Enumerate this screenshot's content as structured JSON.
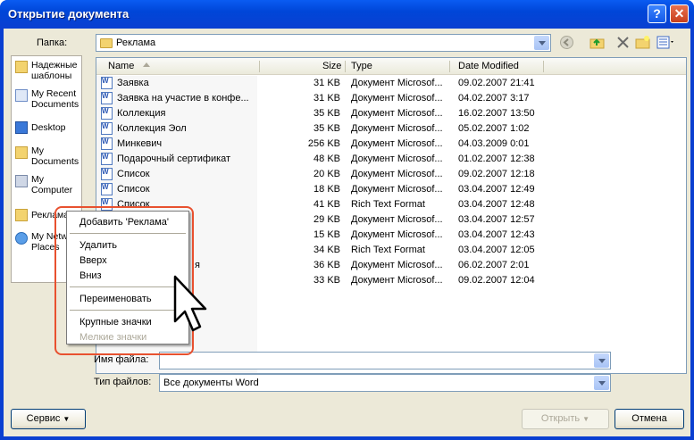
{
  "title": "Открытие документа",
  "titlebar": {
    "help": "?",
    "close": "✕"
  },
  "folder_label": "Папка:",
  "folder_value": "Реклама",
  "places": [
    {
      "label": "Надежные шаблоны"
    },
    {
      "label": "My Recent Documents"
    },
    {
      "label": "Desktop"
    },
    {
      "label": "My Documents"
    },
    {
      "label": "My Computer"
    },
    {
      "label": "Реклама"
    },
    {
      "label": "My Network Places"
    }
  ],
  "columns": [
    "Name",
    "Size",
    "Type",
    "Date Modified"
  ],
  "files": [
    {
      "name": "Заявка",
      "size": "31 KB",
      "type": "Документ Microsof...",
      "date": "09.02.2007 21:41"
    },
    {
      "name": "Заявка на участие в конфе...",
      "size": "31 KB",
      "type": "Документ Microsof...",
      "date": "04.02.2007 3:17"
    },
    {
      "name": "Коллекция",
      "size": "35 KB",
      "type": "Документ Microsof...",
      "date": "16.02.2007 13:50"
    },
    {
      "name": "Коллекция Эол",
      "size": "35 KB",
      "type": "Документ Microsof...",
      "date": "05.02.2007 1:02"
    },
    {
      "name": "Минкевич",
      "size": "256 KB",
      "type": "Документ Microsof...",
      "date": "04.03.2009 0:01"
    },
    {
      "name": "Подарочный сертификат",
      "size": "48 KB",
      "type": "Документ Microsof...",
      "date": "01.02.2007 12:38"
    },
    {
      "name": "Список",
      "size": "20 KB",
      "type": "Документ Microsof...",
      "date": "09.02.2007 12:18"
    },
    {
      "name": "Список",
      "size": "18 KB",
      "type": "Документ Microsof...",
      "date": "03.04.2007 12:49"
    },
    {
      "name": "Список",
      "size": "41 KB",
      "type": "Rich Text Format",
      "date": "03.04.2007 12:48"
    },
    {
      "name": "",
      "size": "29 KB",
      "type": "Документ Microsof...",
      "date": "03.04.2007 12:57"
    },
    {
      "name": "",
      "size": "15 KB",
      "type": "Документ Microsof...",
      "date": "03.04.2007 12:43"
    },
    {
      "name": "",
      "size": "34 KB",
      "type": "Rich Text Format",
      "date": "03.04.2007 12:05"
    },
    {
      "name": "я",
      "size": "36 KB",
      "type": "Документ Microsof...",
      "date": "06.02.2007 2:01"
    },
    {
      "name": "",
      "size": "33 KB",
      "type": "Документ Microsof...",
      "date": "09.02.2007 12:04"
    }
  ],
  "filename_label": "Имя файла:",
  "filename_value": "",
  "filetype_label": "Тип файлов:",
  "filetype_value": "Все документы Word",
  "buttons": {
    "service": "Сервис",
    "open": "Открыть",
    "cancel": "Отмена"
  },
  "context_menu": {
    "add": "Добавить 'Реклама'",
    "delete": "Удалить",
    "up": "Вверх",
    "down": "Вниз",
    "rename": "Переименовать",
    "large_icons": "Крупные значки",
    "small_icons": "Мелкие значки"
  }
}
